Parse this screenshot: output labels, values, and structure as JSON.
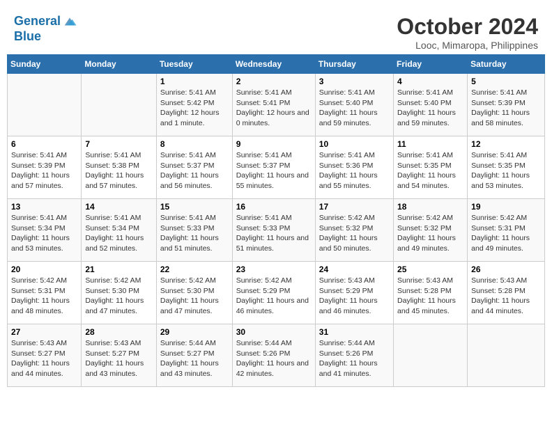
{
  "header": {
    "logo_line1": "General",
    "logo_line2": "Blue",
    "month": "October 2024",
    "location": "Looc, Mimaropa, Philippines"
  },
  "weekdays": [
    "Sunday",
    "Monday",
    "Tuesday",
    "Wednesday",
    "Thursday",
    "Friday",
    "Saturday"
  ],
  "weeks": [
    [
      {
        "day": "",
        "sunrise": "",
        "sunset": "",
        "daylight": ""
      },
      {
        "day": "",
        "sunrise": "",
        "sunset": "",
        "daylight": ""
      },
      {
        "day": "1",
        "sunrise": "Sunrise: 5:41 AM",
        "sunset": "Sunset: 5:42 PM",
        "daylight": "Daylight: 12 hours and 1 minute."
      },
      {
        "day": "2",
        "sunrise": "Sunrise: 5:41 AM",
        "sunset": "Sunset: 5:41 PM",
        "daylight": "Daylight: 12 hours and 0 minutes."
      },
      {
        "day": "3",
        "sunrise": "Sunrise: 5:41 AM",
        "sunset": "Sunset: 5:40 PM",
        "daylight": "Daylight: 11 hours and 59 minutes."
      },
      {
        "day": "4",
        "sunrise": "Sunrise: 5:41 AM",
        "sunset": "Sunset: 5:40 PM",
        "daylight": "Daylight: 11 hours and 59 minutes."
      },
      {
        "day": "5",
        "sunrise": "Sunrise: 5:41 AM",
        "sunset": "Sunset: 5:39 PM",
        "daylight": "Daylight: 11 hours and 58 minutes."
      }
    ],
    [
      {
        "day": "6",
        "sunrise": "Sunrise: 5:41 AM",
        "sunset": "Sunset: 5:39 PM",
        "daylight": "Daylight: 11 hours and 57 minutes."
      },
      {
        "day": "7",
        "sunrise": "Sunrise: 5:41 AM",
        "sunset": "Sunset: 5:38 PM",
        "daylight": "Daylight: 11 hours and 57 minutes."
      },
      {
        "day": "8",
        "sunrise": "Sunrise: 5:41 AM",
        "sunset": "Sunset: 5:37 PM",
        "daylight": "Daylight: 11 hours and 56 minutes."
      },
      {
        "day": "9",
        "sunrise": "Sunrise: 5:41 AM",
        "sunset": "Sunset: 5:37 PM",
        "daylight": "Daylight: 11 hours and 55 minutes."
      },
      {
        "day": "10",
        "sunrise": "Sunrise: 5:41 AM",
        "sunset": "Sunset: 5:36 PM",
        "daylight": "Daylight: 11 hours and 55 minutes."
      },
      {
        "day": "11",
        "sunrise": "Sunrise: 5:41 AM",
        "sunset": "Sunset: 5:35 PM",
        "daylight": "Daylight: 11 hours and 54 minutes."
      },
      {
        "day": "12",
        "sunrise": "Sunrise: 5:41 AM",
        "sunset": "Sunset: 5:35 PM",
        "daylight": "Daylight: 11 hours and 53 minutes."
      }
    ],
    [
      {
        "day": "13",
        "sunrise": "Sunrise: 5:41 AM",
        "sunset": "Sunset: 5:34 PM",
        "daylight": "Daylight: 11 hours and 53 minutes."
      },
      {
        "day": "14",
        "sunrise": "Sunrise: 5:41 AM",
        "sunset": "Sunset: 5:34 PM",
        "daylight": "Daylight: 11 hours and 52 minutes."
      },
      {
        "day": "15",
        "sunrise": "Sunrise: 5:41 AM",
        "sunset": "Sunset: 5:33 PM",
        "daylight": "Daylight: 11 hours and 51 minutes."
      },
      {
        "day": "16",
        "sunrise": "Sunrise: 5:41 AM",
        "sunset": "Sunset: 5:33 PM",
        "daylight": "Daylight: 11 hours and 51 minutes."
      },
      {
        "day": "17",
        "sunrise": "Sunrise: 5:42 AM",
        "sunset": "Sunset: 5:32 PM",
        "daylight": "Daylight: 11 hours and 50 minutes."
      },
      {
        "day": "18",
        "sunrise": "Sunrise: 5:42 AM",
        "sunset": "Sunset: 5:32 PM",
        "daylight": "Daylight: 11 hours and 49 minutes."
      },
      {
        "day": "19",
        "sunrise": "Sunrise: 5:42 AM",
        "sunset": "Sunset: 5:31 PM",
        "daylight": "Daylight: 11 hours and 49 minutes."
      }
    ],
    [
      {
        "day": "20",
        "sunrise": "Sunrise: 5:42 AM",
        "sunset": "Sunset: 5:31 PM",
        "daylight": "Daylight: 11 hours and 48 minutes."
      },
      {
        "day": "21",
        "sunrise": "Sunrise: 5:42 AM",
        "sunset": "Sunset: 5:30 PM",
        "daylight": "Daylight: 11 hours and 47 minutes."
      },
      {
        "day": "22",
        "sunrise": "Sunrise: 5:42 AM",
        "sunset": "Sunset: 5:30 PM",
        "daylight": "Daylight: 11 hours and 47 minutes."
      },
      {
        "day": "23",
        "sunrise": "Sunrise: 5:42 AM",
        "sunset": "Sunset: 5:29 PM",
        "daylight": "Daylight: 11 hours and 46 minutes."
      },
      {
        "day": "24",
        "sunrise": "Sunrise: 5:43 AM",
        "sunset": "Sunset: 5:29 PM",
        "daylight": "Daylight: 11 hours and 46 minutes."
      },
      {
        "day": "25",
        "sunrise": "Sunrise: 5:43 AM",
        "sunset": "Sunset: 5:28 PM",
        "daylight": "Daylight: 11 hours and 45 minutes."
      },
      {
        "day": "26",
        "sunrise": "Sunrise: 5:43 AM",
        "sunset": "Sunset: 5:28 PM",
        "daylight": "Daylight: 11 hours and 44 minutes."
      }
    ],
    [
      {
        "day": "27",
        "sunrise": "Sunrise: 5:43 AM",
        "sunset": "Sunset: 5:27 PM",
        "daylight": "Daylight: 11 hours and 44 minutes."
      },
      {
        "day": "28",
        "sunrise": "Sunrise: 5:43 AM",
        "sunset": "Sunset: 5:27 PM",
        "daylight": "Daylight: 11 hours and 43 minutes."
      },
      {
        "day": "29",
        "sunrise": "Sunrise: 5:44 AM",
        "sunset": "Sunset: 5:27 PM",
        "daylight": "Daylight: 11 hours and 43 minutes."
      },
      {
        "day": "30",
        "sunrise": "Sunrise: 5:44 AM",
        "sunset": "Sunset: 5:26 PM",
        "daylight": "Daylight: 11 hours and 42 minutes."
      },
      {
        "day": "31",
        "sunrise": "Sunrise: 5:44 AM",
        "sunset": "Sunset: 5:26 PM",
        "daylight": "Daylight: 11 hours and 41 minutes."
      },
      {
        "day": "",
        "sunrise": "",
        "sunset": "",
        "daylight": ""
      },
      {
        "day": "",
        "sunrise": "",
        "sunset": "",
        "daylight": ""
      }
    ]
  ]
}
